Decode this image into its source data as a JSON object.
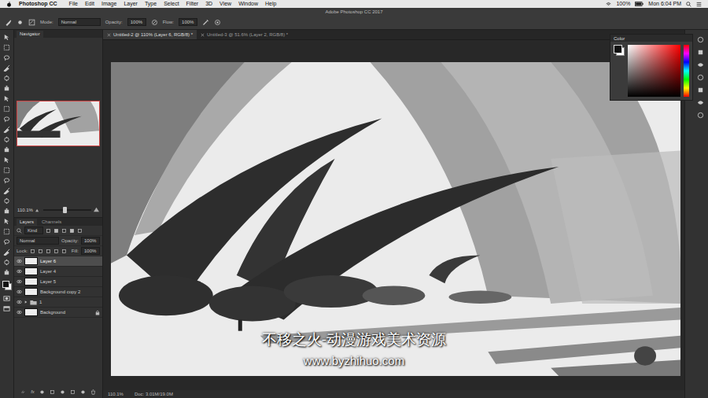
{
  "menu_bar": {
    "app": "Photoshop CC",
    "items": [
      "File",
      "Edit",
      "Image",
      "Layer",
      "Type",
      "Select",
      "Filter",
      "3D",
      "View",
      "Window",
      "Help"
    ],
    "battery": "100%",
    "clock": "Mon 6:04 PM"
  },
  "window": {
    "title": "Adobe Photoshop CC 2017"
  },
  "options_bar": {
    "mode_label": "Mode:",
    "mode": "Normal",
    "opacity_label": "Opacity:",
    "opacity": "100%",
    "flow_label": "Flow:",
    "flow": "100%"
  },
  "tabs": [
    {
      "label": "Untitled-2 @ 110% (Layer 6, RGB/8) *",
      "selected": true
    },
    {
      "label": "Untitled-3 @ 51.6% (Layer 2, RGB/8) *",
      "selected": false
    }
  ],
  "navigator": {
    "title": "Navigator",
    "zoom": "110.1%",
    "level": 0.45
  },
  "layers_panel": {
    "tabs": [
      {
        "label": "Layers",
        "selected": true
      },
      {
        "label": "Channels",
        "selected": false
      }
    ],
    "filter": "Kind",
    "blend_mode": "Normal",
    "opacity_label": "Opacity:",
    "opacity": "100%",
    "lock_label": "Lock:",
    "fill_label": "Fill:",
    "fill": "100%",
    "layers": [
      {
        "name": "Layer 6",
        "kind": "layer",
        "visible": true,
        "selected": true,
        "locked": false
      },
      {
        "name": "Layer 4",
        "kind": "layer",
        "visible": true,
        "selected": false,
        "locked": false
      },
      {
        "name": "Layer 5",
        "kind": "layer",
        "visible": true,
        "selected": false,
        "locked": false
      },
      {
        "name": "Background copy 2",
        "kind": "layer",
        "visible": true,
        "selected": false,
        "locked": false
      },
      {
        "name": "1",
        "kind": "group",
        "visible": true,
        "selected": false,
        "locked": false
      },
      {
        "name": "Background",
        "kind": "layer",
        "visible": true,
        "selected": false,
        "locked": true
      }
    ],
    "fx_label": "fx"
  },
  "color_panel": {
    "title": "Color"
  },
  "status_bar": {
    "zoom": "110.1%",
    "doc": "Doc: 3.01M/19.0M"
  },
  "watermark": {
    "title": "不移之火-动漫游戏美术资源",
    "url": "www.byzhihuo.com"
  }
}
